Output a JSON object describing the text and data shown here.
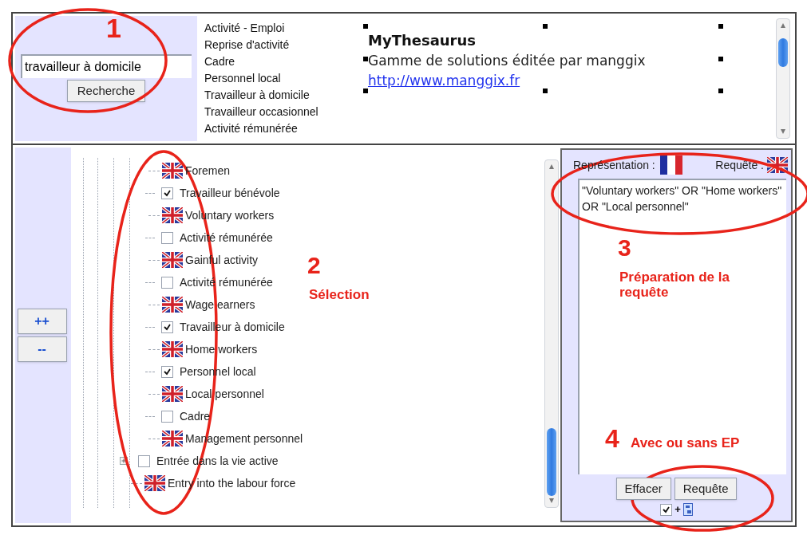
{
  "search": {
    "value": "travailleur à domicile",
    "button": "Recherche"
  },
  "suggestions": [
    "Activité - Emploi",
    "Reprise d'activité",
    "Cadre",
    "Personnel local",
    "Travailleur à domicile",
    "Travailleur occasionnel",
    "Activité rémunérée"
  ],
  "info": {
    "title": "MyThesaurus",
    "subtitle": "Gamme de solutions éditée par manggix",
    "link": "http://www.manggix.fr"
  },
  "zoom_buttons": [
    "++",
    "--"
  ],
  "tree": {
    "nodes": [
      {
        "kind": "group",
        "children": [
          {
            "kind": "translation",
            "label": "Foremen"
          },
          {
            "kind": "term",
            "label": "Travailleur bénévole",
            "checked": true,
            "expandable": false,
            "children": [
              {
                "kind": "translation",
                "label": "Voluntary workers"
              }
            ]
          },
          {
            "kind": "term",
            "label": "Activité rémunérée",
            "checked": false,
            "expandable": false,
            "children": [
              {
                "kind": "translation",
                "label": "Gainful activity"
              }
            ]
          },
          {
            "kind": "term",
            "label": "Activité rémunérée",
            "checked": false,
            "expandable": false,
            "children": [
              {
                "kind": "translation",
                "label": "Wage earners"
              }
            ]
          },
          {
            "kind": "term",
            "label": "Travailleur à domicile",
            "checked": true,
            "expandable": false,
            "children": [
              {
                "kind": "translation",
                "label": "Home workers"
              }
            ]
          },
          {
            "kind": "term",
            "label": "Personnel local",
            "checked": true,
            "expandable": false,
            "children": [
              {
                "kind": "translation",
                "label": "Local personnel"
              }
            ]
          },
          {
            "kind": "term",
            "label": "Cadre",
            "checked": false,
            "expandable": false,
            "children": [
              {
                "kind": "translation",
                "label": "Management personnel"
              }
            ]
          }
        ]
      },
      {
        "kind": "term",
        "label": "Entrée dans la vie active",
        "checked": false,
        "expandable": true,
        "children": [
          {
            "kind": "translation",
            "label": "Entry into the labour force"
          }
        ]
      }
    ]
  },
  "query_panel": {
    "representation_label": "Représentation :",
    "query_label": "Requête :",
    "query": "\"Voluntary workers\" OR \"Home workers\" OR \"Local personnel\"",
    "buttons": [
      "Effacer",
      "Requête"
    ],
    "ep_checked": true,
    "ep_sign": "+"
  },
  "annotations": [
    {
      "number": "1"
    },
    {
      "number": "2",
      "label": "Sélection"
    },
    {
      "number": "3",
      "label": "Préparation de la requête"
    },
    {
      "number": "4",
      "label": "Avec ou sans EP"
    }
  ]
}
